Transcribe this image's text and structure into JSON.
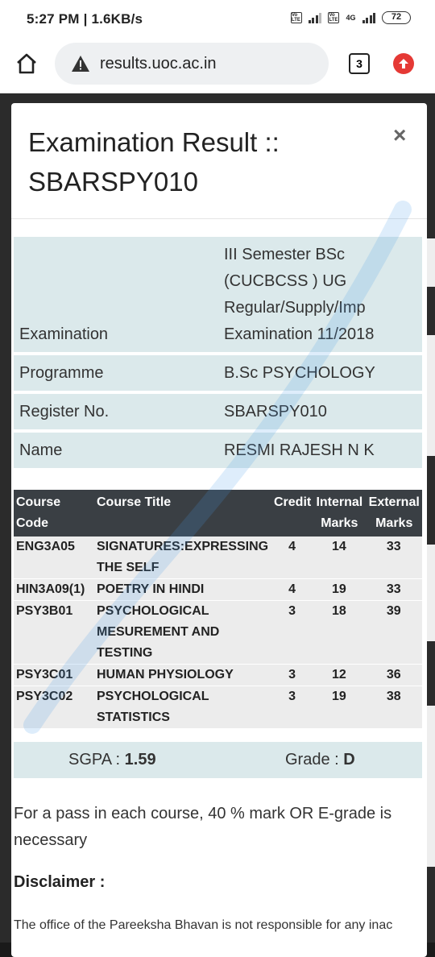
{
  "status_bar": {
    "time": "5:27 PM | 1.6KB/s",
    "sim1_badge": "Vo LTE",
    "sim2_badge": "Vo LTE",
    "network": "4G",
    "battery": "72"
  },
  "browser": {
    "url": "results.uoc.ac.in",
    "tab_count": "3"
  },
  "modal": {
    "title": "Examination Result :: SBARSPY010",
    "close_label": "×",
    "info": [
      {
        "label": "Examination",
        "value": "III Semester BSc (CUCBCSS ) UG Regular/Supply/Imp Examination 11/2018"
      },
      {
        "label": "Programme",
        "value": "B.Sc PSYCHOLOGY"
      },
      {
        "label": "Register No.",
        "value": "SBARSPY010"
      },
      {
        "label": "Name",
        "value": "RESMI RAJESH N K"
      }
    ],
    "marks_headers": {
      "code": "Course Code",
      "title": "Course Title",
      "credit": "Credit",
      "internal": "Internal Marks",
      "external": "External Marks"
    },
    "courses": [
      {
        "code": "ENG3A05",
        "title": "SIGNATURES:EXPRESSING THE SELF",
        "credit": "4",
        "internal": "14",
        "external": "33"
      },
      {
        "code": "HIN3A09(1)",
        "title": "POETRY IN HINDI",
        "credit": "4",
        "internal": "19",
        "external": "33"
      },
      {
        "code": "PSY3B01",
        "title": "PSYCHOLOGICAL MESUREMENT AND TESTING",
        "credit": "3",
        "internal": "18",
        "external": "39"
      },
      {
        "code": "PSY3C01",
        "title": "HUMAN PHYSIOLOGY",
        "credit": "3",
        "internal": "12",
        "external": "36"
      },
      {
        "code": "PSY3C02",
        "title": "PSYCHOLOGICAL STATISTICS",
        "credit": "3",
        "internal": "19",
        "external": "38"
      }
    ],
    "sgpa_label": "SGPA : ",
    "sgpa_value": "1.59",
    "grade_label": "Grade : ",
    "grade_value": "D",
    "pass_note": "For a pass in each course, 40 % mark OR E-grade is necessary",
    "disclaimer_heading": "Disclaimer :",
    "disclaimer_text": "The office of the Pareeksha Bhavan is not responsible for any inac"
  },
  "colors": {
    "info_row_bg": "#dbe9eb",
    "table_header_bg": "#3a3f44",
    "update_badge": "#e53935"
  }
}
